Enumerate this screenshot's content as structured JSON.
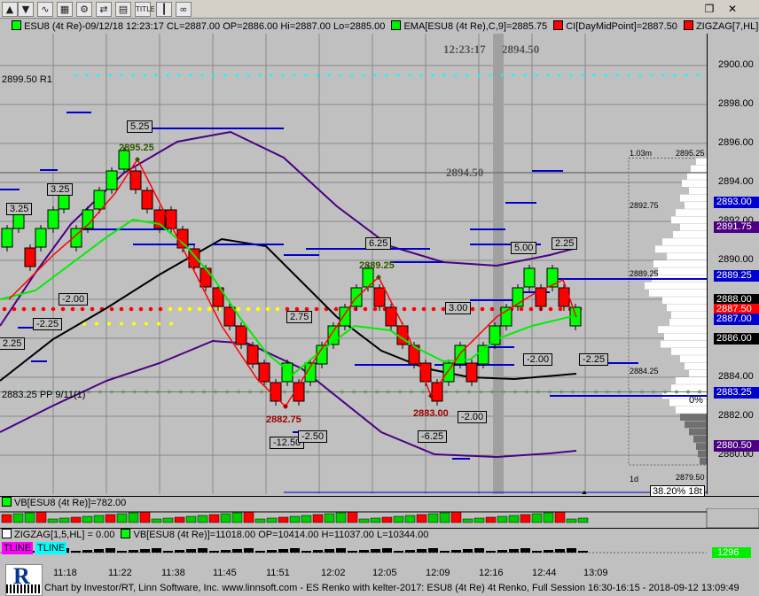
{
  "toolbar": {
    "buttons": [
      "up-arrow",
      "down-arrow",
      "line-chart",
      "grid",
      "settings",
      "compare",
      "calendar",
      "candles",
      "title",
      "glasses"
    ],
    "title_btn": "TITLE"
  },
  "header": {
    "main": "ESU8 (4t Re)-09/12/18 12:23:17 CL=2887.00 OP=2886.00 Hi=2887.00 Lo=2885.00",
    "ema": "EMA[ESU8 (4t Re),C,9]=2885.75",
    "ci": "CI[DayMidPoint]=2887.50",
    "zigzag": "ZIGZAG[7,HL]="
  },
  "colors": {
    "bg": "#c0c0c0",
    "up": "#00ff00",
    "down": "#ff0000",
    "ema": "#00ee00",
    "mid": "#000000",
    "band": "#4b0082",
    "blue": "#0000cc",
    "zig": "#ff0000"
  },
  "chart": {
    "time_display": "12:23:17",
    "last_price_display": "2894.50",
    "mid_label": "2894.50",
    "r1_label": "2899.50 R1",
    "pp_label": "2883.25 PP 9/11(1)",
    "fib_label": "38.20% 18t",
    "pct_label": "0%"
  },
  "price_axis": {
    "ticks": [
      "2900.00",
      "2898.00",
      "2896.00",
      "2894.00",
      "2892.00",
      "2890.00",
      "2888.00",
      "2886.00",
      "2884.00",
      "2882.00",
      "2880.00"
    ],
    "tags": [
      {
        "text": "2893.00",
        "bg": "#0000cc",
        "fg": "#ffffff"
      },
      {
        "text": "2891.75",
        "bg": "#4b0082",
        "fg": "#ffffff"
      },
      {
        "text": "2889.25",
        "bg": "#0000cc",
        "fg": "#ffffff"
      },
      {
        "text": "2888.00",
        "bg": "#000000",
        "fg": "#ffffff"
      },
      {
        "text": "2887.50",
        "bg": "#ff0000",
        "fg": "#ffffff"
      },
      {
        "text": "2887.00",
        "bg": "#0000cc",
        "fg": "#ffffff"
      },
      {
        "text": "2886.00",
        "bg": "#000000",
        "fg": "#ffffff"
      },
      {
        "text": "2883.25",
        "bg": "#0000cc",
        "fg": "#ffffff"
      },
      {
        "text": "2880.50",
        "bg": "#4b0082",
        "fg": "#ffffff"
      }
    ]
  },
  "volume_profile": {
    "top_left": "1.03m",
    "top_right": "2895.25",
    "l1": "2892.75",
    "l2": "2889.25",
    "l3": "2884.25",
    "bot_left": "1d",
    "bot_right": "2879.50"
  },
  "annotations": {
    "swing_labels": [
      "2895.25",
      "2889.25",
      "2882.75",
      "2883.00"
    ],
    "boxes": [
      "5.25",
      "3.25",
      "3.25",
      "-2.00",
      "-2.25",
      "2.25",
      "6.25",
      "2.75",
      "3.00",
      "5.00",
      "2.25",
      "-2.00",
      "-2.25",
      "-2.00",
      "-12.50",
      "-2.50",
      "-6.25"
    ]
  },
  "vb_pane": {
    "label": "VB[ESU8 (4t Re)]=782.00"
  },
  "zz_pane": {
    "label": "ZIGZAG[1,5,HL] = 0.00",
    "vb_label": "VB[ESU8 (4t Re)]=11018.00 OP=10414.00 H=11037.00 L=10344.00",
    "tline1": "TLINE",
    "tline2": "TLINE",
    "value_tag": "1296"
  },
  "time_axis": {
    "labels": [
      "11:18",
      "11:22",
      "11:38",
      "11:45",
      "11:51",
      "12:02",
      "12:05",
      "12:09",
      "12:16",
      "12:44",
      "13:09"
    ]
  },
  "footer": {
    "text": "Chart by Investor/RT, Linn Software, Inc. www.linnsoft.com - ES Renko with kelter-2017: ESU8 (4t Re) 4t Renko, Full Session 16:30-16:15 - 2018-09-12 13:09:49"
  }
}
